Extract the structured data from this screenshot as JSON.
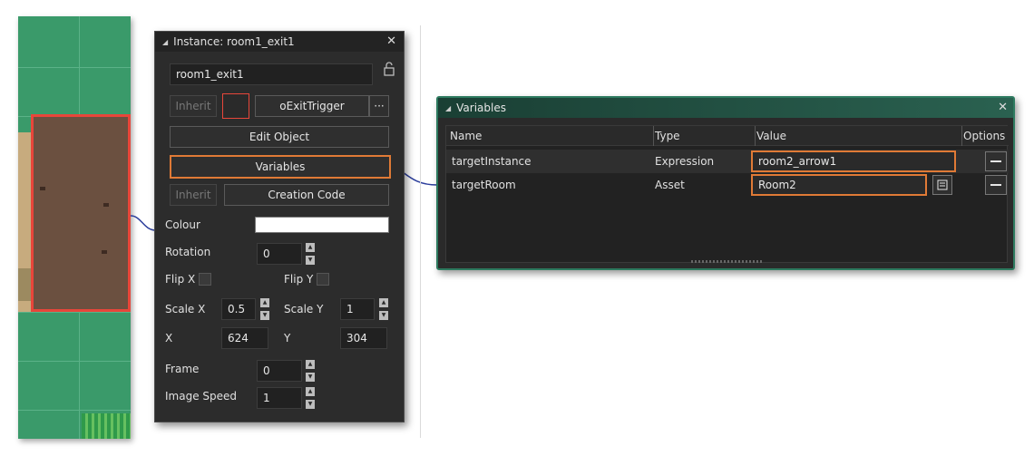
{
  "instance_panel": {
    "title": "Instance: room1_exit1",
    "name_value": "room1_exit1",
    "inherit_label": "Inherit",
    "object_name": "oExitTrigger",
    "object_menu_label": "···",
    "edit_object_label": "Edit Object",
    "variables_label": "Variables",
    "creation_inherit_label": "Inherit",
    "creation_code_label": "Creation Code",
    "colour_label": "Colour",
    "colour_value": "#ffffff",
    "rotation_label": "Rotation",
    "rotation_value": "0",
    "flip_x_label": "Flip X",
    "flip_y_label": "Flip Y",
    "scale_x_label": "Scale X",
    "scale_x_value": "0.5",
    "scale_y_label": "Scale Y",
    "scale_y_value": "1",
    "x_label": "X",
    "x_value": "624",
    "y_label": "Y",
    "y_value": "304",
    "frame_label": "Frame",
    "frame_value": "0",
    "image_speed_label": "Image Speed",
    "image_speed_value": "1"
  },
  "variables_window": {
    "title": "Variables",
    "columns": [
      "Name",
      "Type",
      "Value",
      "Options"
    ],
    "rows": [
      {
        "name": "targetInstance",
        "type": "Expression",
        "value": "room2_arrow1"
      },
      {
        "name": "targetRoom",
        "type": "Asset",
        "value": "Room2"
      }
    ]
  },
  "colors": {
    "accent_orange": "#e07a36",
    "selection_red": "#e8463a",
    "variables_border": "#2d7a5f",
    "connector": "#2c3e9c"
  }
}
